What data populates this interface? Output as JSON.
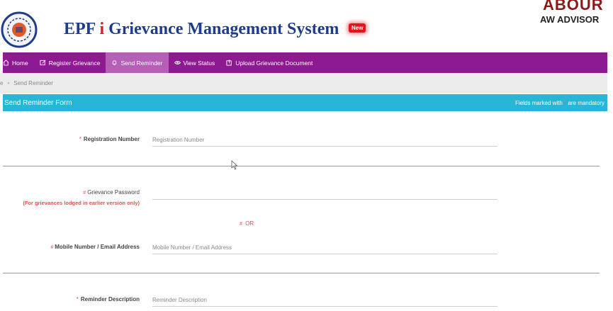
{
  "header": {
    "title_part1": "EPF ",
    "title_i": "i",
    "title_part2": " Grievance Management System",
    "new_badge": "New",
    "brand_line1": "ABOUR",
    "brand_line2": "AW ADVISOR",
    "colors": {
      "title": "#1f3c8c",
      "accent_i": "#d0202a",
      "badge": "#e5141c"
    }
  },
  "nav": {
    "items": [
      {
        "label": "Home",
        "icon": "home-icon"
      },
      {
        "label": "Register Grievance",
        "icon": "edit-icon"
      },
      {
        "label": "Send Reminder",
        "icon": "bell-icon",
        "active": true
      },
      {
        "label": "View Status",
        "icon": "eye-icon"
      },
      {
        "label": "Upload Grievance Document",
        "icon": "upload-icon"
      }
    ],
    "colors": {
      "bar": "#8e1a91",
      "active": "#b560b6"
    }
  },
  "breadcrumb": {
    "home": "e",
    "current": "Send Reminder"
  },
  "form": {
    "title": "Send Reminder Form",
    "note_pre": "Fields marked with ",
    "note_star": "*",
    "note_post": " are mandatory",
    "registration": {
      "label": "Registration Number",
      "placeholder": "Registration Number",
      "value": ""
    },
    "password": {
      "label": "Grievance Password",
      "hint": "(For grievances lodged in earlier version only)",
      "value": ""
    },
    "or_text": "OR",
    "mobile": {
      "label": "Mobile Number / Email Address",
      "placeholder": "Mobile Number / Email Address",
      "value": ""
    },
    "reminder": {
      "label": "Reminder Description",
      "placeholder": "Reminder Description",
      "value": ""
    },
    "colors": {
      "header": "#27b6d6",
      "required": "#d9534f"
    }
  }
}
